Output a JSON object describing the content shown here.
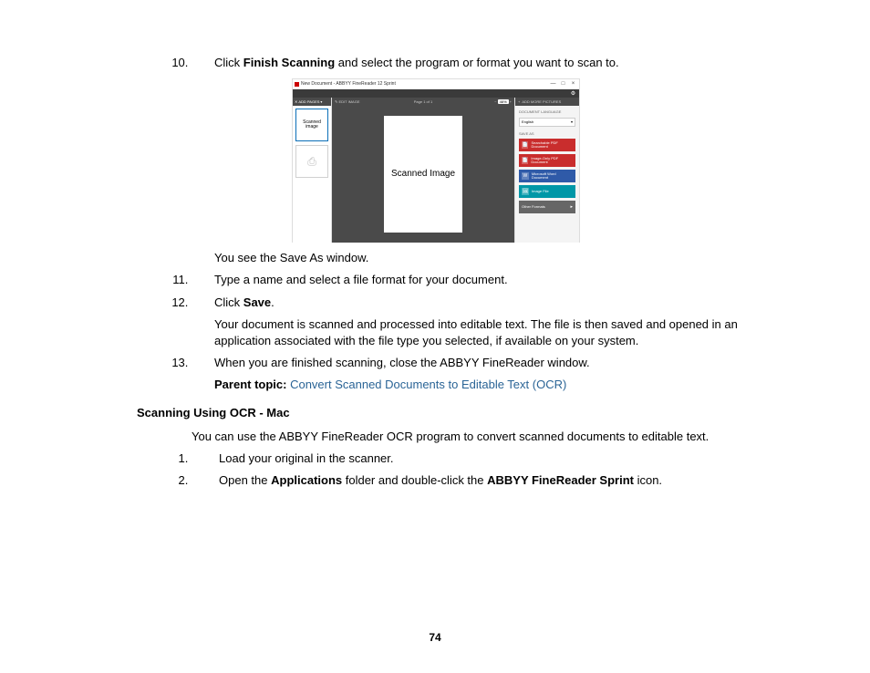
{
  "steps_cont": {
    "start": 10,
    "s10_prefix": "Click ",
    "s10_bold": "Finish Scanning",
    "s10_suffix": " and select the program or format you want to scan to.",
    "s10_after_fig": "You see the Save As window.",
    "s11": "Type a name and select a file format for your document.",
    "s12_prefix": "Click ",
    "s12_bold": "Save",
    "s12_suffix": ".",
    "s12_after": "Your document is scanned and processed into editable text. The file is then saved and opened in an application associated with the file type you selected, if available on your system.",
    "s13": "When you are finished scanning, close the ABBYY FineReader window."
  },
  "parent_topic": {
    "label": "Parent topic: ",
    "link": "Convert Scanned Documents to Editable Text (OCR)"
  },
  "section2": {
    "heading": "Scanning Using OCR - Mac",
    "intro": "You can use the ABBYY FineReader OCR program to convert scanned documents to editable text.",
    "s1": "Load your original in the scanner.",
    "s2_prefix": "Open the ",
    "s2_b1": "Applications",
    "s2_mid": " folder and double-click the ",
    "s2_b2": "ABBYY FineReader Sprint",
    "s2_suffix": " icon."
  },
  "figure": {
    "window_title": "New Document - ABBYY FineReader 12 Sprint",
    "minimize": "—",
    "maximize": "□",
    "close": "×",
    "gear": "⚙",
    "left_hdr_x": "✕",
    "left_hdr": "ADD PAGES",
    "left_hdr_caret": "▾",
    "thumb_label": "Scanned image",
    "thumb2_icon": "⎙",
    "center_edit": "✎ EDIT IMAGE",
    "center_page": "Page 1 of 1",
    "zoom_minus": "−",
    "zoom_val": "46%",
    "zoom_plus": "+",
    "page_text": "Scanned Image",
    "right_hdr_icon": "+",
    "right_hdr": "ADD MORE PICTURES",
    "lang_label": "DOCUMENT LANGUAGE",
    "lang_value": "English",
    "lang_caret": "▾",
    "saveas_label": "SAVE AS",
    "opt1_icon": "📄",
    "opt1": "Searchable PDF Document",
    "opt2_icon": "📄",
    "opt2": "Image-Only PDF Document",
    "opt3_icon": "W",
    "opt3": "Microsoft Word Document",
    "opt4_icon": "🖼",
    "opt4": "Image File",
    "opt5": "Other Formats",
    "opt5_arrow": "▸"
  },
  "page_number": "74"
}
